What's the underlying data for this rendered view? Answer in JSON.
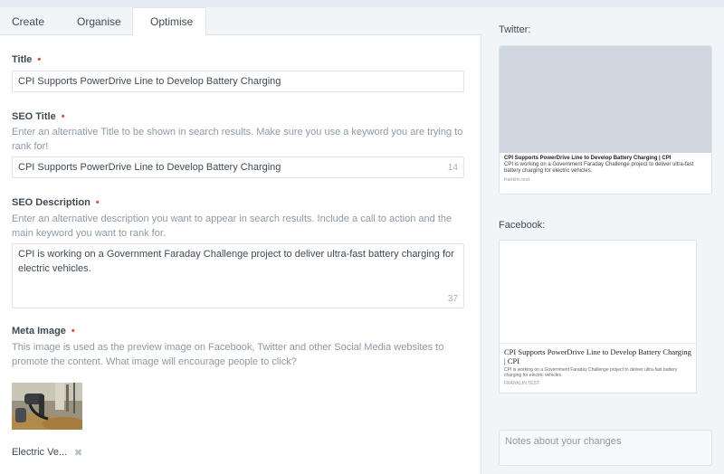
{
  "tabs": [
    {
      "label": "Create"
    },
    {
      "label": "Organise"
    },
    {
      "label": "Optimise"
    }
  ],
  "fields": {
    "title": {
      "label": "Title",
      "required_mark": "•",
      "value": "CPI Supports PowerDrive Line to Develop Battery Charging"
    },
    "seo_title": {
      "label": "SEO Title",
      "required_mark": "•",
      "help": "Enter an alternative Title to be shown in search results. Make sure you use a keyword you are trying to rank for!",
      "value": "CPI Supports PowerDrive Line to Develop Battery Charging",
      "count": "14"
    },
    "seo_description": {
      "label": "SEO Description",
      "required_mark": "•",
      "help": "Enter an alternative description you want to appear in search results. Include a call to action and the main keyword you want to rank for.",
      "value": "CPI is working on a Government Faraday Challenge project to deliver ultra-fast battery charging for electric vehicles.",
      "count": "37"
    },
    "meta_image": {
      "label": "Meta Image",
      "required_mark": "•",
      "help": "This image is used as the preview image on Facebook, Twitter and other Social Media websites to promote the content. What image will encourage people to click?",
      "caption": "Electric Ve...",
      "remove_icon": "close-icon"
    }
  },
  "twitter": {
    "label": "Twitter:",
    "card_title": "CPI Supports PowerDrive Line to Develop Battery Charging | CPI",
    "card_description": "CPI is working on a Government Faraday Challenge project to deliver ultra-fast battery charging for electric vehicles.",
    "domain": "franklin.test"
  },
  "facebook": {
    "label": "Facebook:",
    "card_title": "CPI Supports PowerDrive Line to Develop Battery Charging | CPI",
    "card_description": "CPI is working on a Government Faraday Challenge project to deliver ultra-fast battery charging for electric vehicles.",
    "domain": "FRANKLIN.TEST"
  },
  "notes": {
    "placeholder": "Notes about your changes"
  },
  "colors": {
    "required": "#e0443c",
    "background": "#f1f5f8",
    "panel": "#ffffff",
    "border": "#dde4eb",
    "muted_text": "#8d99a6"
  }
}
